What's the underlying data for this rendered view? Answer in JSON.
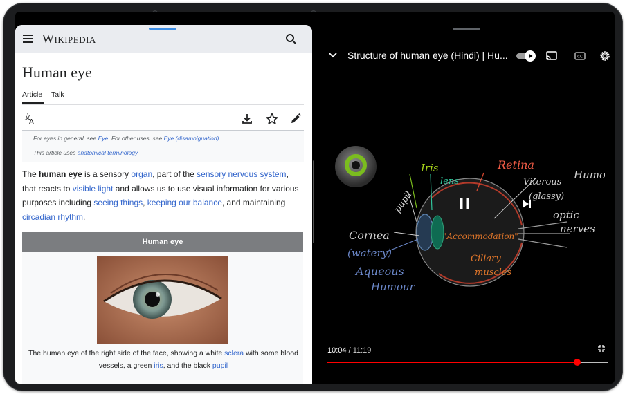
{
  "wiki": {
    "logo": "Wikipedia",
    "title": "Human eye",
    "tabs": {
      "article": "Article",
      "talk": "Talk"
    },
    "hatnote": {
      "line1": {
        "pre": "For eyes in general, see ",
        "link1": "Eye",
        "mid": ". For other uses, see ",
        "link2": "Eye (disambiguation)",
        "post": "."
      },
      "line2": {
        "pre": "This article uses ",
        "link": "anatomical terminology",
        "post": "."
      }
    },
    "intro": {
      "t1": "The ",
      "b1": "human eye",
      "t2": " is a sensory ",
      "l1": "organ",
      "t3": ", part of the ",
      "l2": "sensory nervous system",
      "t4": ", that reacts to ",
      "l3": "visible light",
      "t5": " and allows us to use visual information for various purposes including ",
      "l4": "seeing things",
      "t6": ", ",
      "l5": "keeping our balance",
      "t7": ", and maintaining ",
      "l6": "circadian rhythm",
      "t8": "."
    },
    "infobox": {
      "title": "Human eye",
      "caption": {
        "t1": "The human eye of the right side of the face, showing a white ",
        "l1": "sclera",
        "t2": " with some blood vessels, a green ",
        "l2": "iris",
        "t3": ", and the black ",
        "l3": "pupil"
      }
    }
  },
  "video": {
    "title": "Structure of human eye (Hindi) | Hu...",
    "current_time": "10:04",
    "separator": " / ",
    "duration": "11:19",
    "progress": 0.889,
    "board_labels": {
      "iris": "Iris",
      "lens": "lens",
      "pupil": "pupil",
      "retina": "Retina",
      "viterous": "Viterous",
      "glassy": "(glassy)",
      "humour_right": "Humour",
      "optic": "optic",
      "nerves": "nerves",
      "cornea": "Cornea",
      "watery": "(watery)",
      "aqueous": "Aqueous",
      "humour_left": "Humour",
      "accommodation": "\"Accommodation\"",
      "ciliary": "Ciliary",
      "muscles": "muscles"
    }
  },
  "colors": {
    "link": "#3366cc",
    "progress": "#ff0000",
    "infobox_head": "#7b7d80"
  }
}
